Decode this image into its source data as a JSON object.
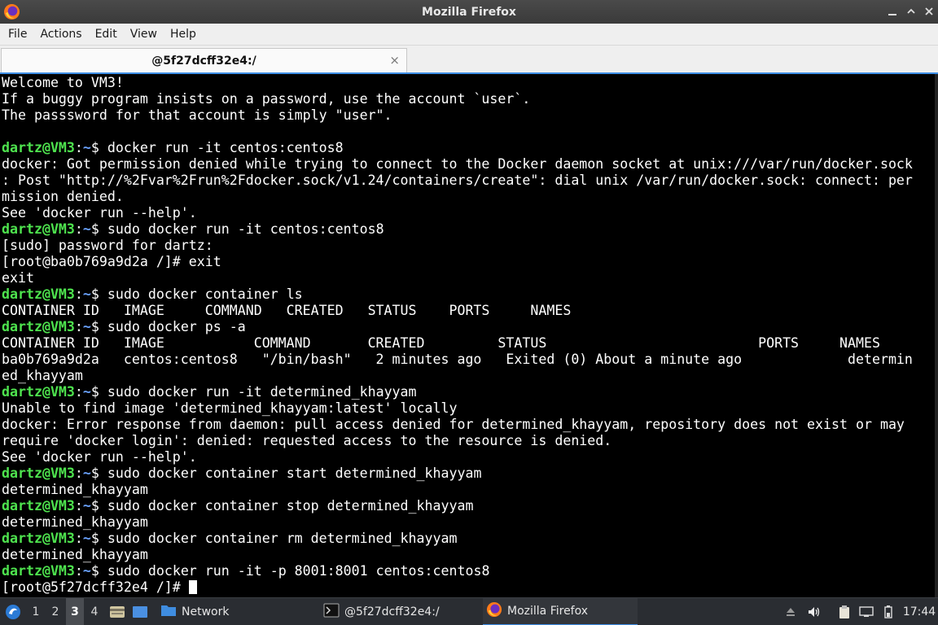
{
  "window": {
    "title": "Mozilla Firefox",
    "controls": [
      "minimize",
      "maximize",
      "close"
    ]
  },
  "menu": [
    "File",
    "Actions",
    "Edit",
    "View",
    "Help"
  ],
  "tab": {
    "label": "@5f27dcff32e4:/",
    "close": "×"
  },
  "terminal": {
    "lines": [
      [
        {
          "t": "Welcome to VM3!"
        }
      ],
      [
        {
          "t": "If a buggy program insists on a password, use the account `user`."
        }
      ],
      [
        {
          "t": "The passsword for that account is simply \"user\"."
        }
      ],
      [
        {
          "t": ""
        }
      ],
      [
        {
          "t": "dartz@VM3",
          "c": "user"
        },
        {
          "t": ":"
        },
        {
          "t": "~",
          "c": "path"
        },
        {
          "t": "$ docker run -it centos:centos8"
        }
      ],
      [
        {
          "t": "docker: Got permission denied while trying to connect to the Docker daemon socket at unix:///var/run/docker.sock"
        }
      ],
      [
        {
          "t": ": Post \"http://%2Fvar%2Frun%2Fdocker.sock/v1.24/containers/create\": dial unix /var/run/docker.sock: connect: per"
        }
      ],
      [
        {
          "t": "mission denied."
        }
      ],
      [
        {
          "t": "See 'docker run --help'."
        }
      ],
      [
        {
          "t": "dartz@VM3",
          "c": "user"
        },
        {
          "t": ":"
        },
        {
          "t": "~",
          "c": "path"
        },
        {
          "t": "$ sudo docker run -it centos:centos8"
        }
      ],
      [
        {
          "t": "[sudo] password for dartz:"
        }
      ],
      [
        {
          "t": "[root@ba0b769a9d2a /]# exit"
        }
      ],
      [
        {
          "t": "exit"
        }
      ],
      [
        {
          "t": "dartz@VM3",
          "c": "user"
        },
        {
          "t": ":"
        },
        {
          "t": "~",
          "c": "path"
        },
        {
          "t": "$ sudo docker container ls"
        }
      ],
      [
        {
          "t": "CONTAINER ID   IMAGE     COMMAND   CREATED   STATUS    PORTS     NAMES"
        }
      ],
      [
        {
          "t": "dartz@VM3",
          "c": "user"
        },
        {
          "t": ":"
        },
        {
          "t": "~",
          "c": "path"
        },
        {
          "t": "$ sudo docker ps -a"
        }
      ],
      [
        {
          "t": "CONTAINER ID   IMAGE           COMMAND       CREATED         STATUS                          PORTS     NAMES"
        }
      ],
      [
        {
          "t": "ba0b769a9d2a   centos:centos8   \"/bin/bash\"   2 minutes ago   Exited (0) About a minute ago             determin"
        }
      ],
      [
        {
          "t": "ed_khayyam"
        }
      ],
      [
        {
          "t": "dartz@VM3",
          "c": "user"
        },
        {
          "t": ":"
        },
        {
          "t": "~",
          "c": "path"
        },
        {
          "t": "$ sudo docker run -it determined_khayyam"
        }
      ],
      [
        {
          "t": "Unable to find image 'determined_khayyam:latest' locally"
        }
      ],
      [
        {
          "t": "docker: Error response from daemon: pull access denied for determined_khayyam, repository does not exist or may"
        }
      ],
      [
        {
          "t": "require 'docker login': denied: requested access to the resource is denied."
        }
      ],
      [
        {
          "t": "See 'docker run --help'."
        }
      ],
      [
        {
          "t": "dartz@VM3",
          "c": "user"
        },
        {
          "t": ":"
        },
        {
          "t": "~",
          "c": "path"
        },
        {
          "t": "$ sudo docker container start determined_khayyam"
        }
      ],
      [
        {
          "t": "determined_khayyam"
        }
      ],
      [
        {
          "t": "dartz@VM3",
          "c": "user"
        },
        {
          "t": ":"
        },
        {
          "t": "~",
          "c": "path"
        },
        {
          "t": "$ sudo docker container stop determined_khayyam"
        }
      ],
      [
        {
          "t": "determined_khayyam"
        }
      ],
      [
        {
          "t": "dartz@VM3",
          "c": "user"
        },
        {
          "t": ":"
        },
        {
          "t": "~",
          "c": "path"
        },
        {
          "t": "$ sudo docker container rm determined_khayyam"
        }
      ],
      [
        {
          "t": "determined_khayyam"
        }
      ],
      [
        {
          "t": "dartz@VM3",
          "c": "user"
        },
        {
          "t": ":"
        },
        {
          "t": "~",
          "c": "path"
        },
        {
          "t": "$ sudo docker run -it -p 8001:8001 centos:centos8"
        }
      ],
      [
        {
          "t": "[root@5f27dcff32e4 /]# "
        },
        {
          "t": "",
          "c": "cursor"
        }
      ]
    ]
  },
  "taskbar": {
    "workspaces": [
      "1",
      "2",
      "3",
      "4"
    ],
    "active_workspace": "3",
    "tasks": [
      {
        "label": "Network",
        "icon": "folder-icon"
      },
      {
        "label": "@5f27dcff32e4:/",
        "icon": "terminal-icon"
      },
      {
        "label": "Mozilla Firefox",
        "icon": "firefox-icon"
      }
    ],
    "clock": "17:44"
  },
  "colors": {
    "prompt_user": "#4ee34e",
    "prompt_path": "#6aa2ff",
    "accent": "#3d8ee6"
  }
}
